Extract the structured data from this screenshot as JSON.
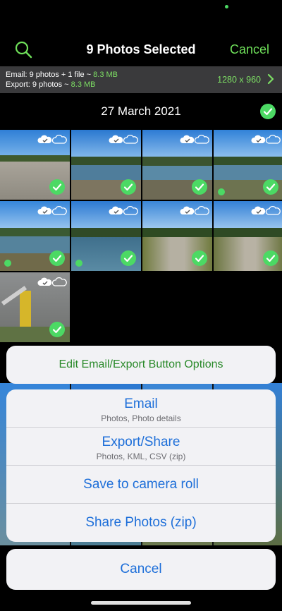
{
  "nav": {
    "title": "9 Photos Selected",
    "cancel_label": "Cancel"
  },
  "info": {
    "email_prefix": "Email: 9 photos + 1 file ~ ",
    "email_size": "8.3 MB",
    "export_prefix": "Export: 9 photos ~ ",
    "export_size": "8.3 MB",
    "resolution": "1280 x 960"
  },
  "section": {
    "date": "27 March 2021"
  },
  "sheet": {
    "edit_options_label": "Edit Email/Export Button Options",
    "items": [
      {
        "label": "Email",
        "sublabel": "Photos, Photo details"
      },
      {
        "label": "Export/Share",
        "sublabel": "Photos, KML, CSV (zip)"
      },
      {
        "label": "Save to camera roll"
      },
      {
        "label": "Share Photos (zip)"
      }
    ],
    "cancel_label": "Cancel"
  },
  "colors": {
    "accent_green": "#6fe05a",
    "action_blue": "#1e6fd9",
    "sheet_bg": "#f2f2f5"
  },
  "icons": {
    "search": "search-icon",
    "chevron": "chevron-right-icon",
    "check": "check-circle-icon",
    "cloud_synced": "cloud-check-icon",
    "cloud_outline": "cloud-icon"
  }
}
